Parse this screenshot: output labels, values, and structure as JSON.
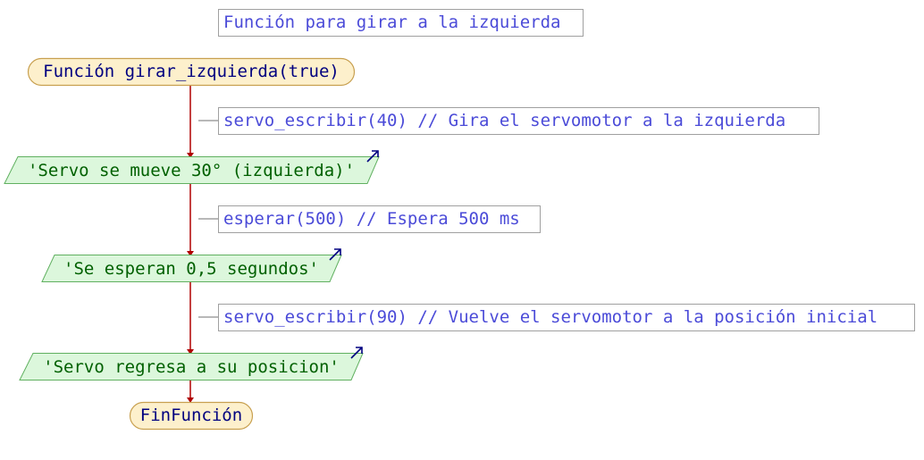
{
  "diagram": {
    "title_comment": "Función para girar a la izquierda",
    "start": "Función girar_izquierda(true)",
    "steps": [
      {
        "instruction": "servo_escribir(40) // Gira el servomotor a la izquierda",
        "output": "'Servo se mueve 30° (izquierda)'"
      },
      {
        "instruction": "esperar(500) // Espera 500 ms",
        "output": "'Se esperan 0,5 segundos'"
      },
      {
        "instruction": "servo_escribir(90) // Vuelve el servomotor a la posición inicial",
        "output": "'Servo regresa a su posicion'"
      }
    ],
    "end": "FinFunción"
  },
  "colors": {
    "flow_line": "#b00000",
    "comment_text": "#4b4bd8",
    "terminal_fill": "#fdf0cc",
    "io_fill": "#dcf7dc",
    "io_text": "#006000",
    "terminal_text": "#000080"
  }
}
